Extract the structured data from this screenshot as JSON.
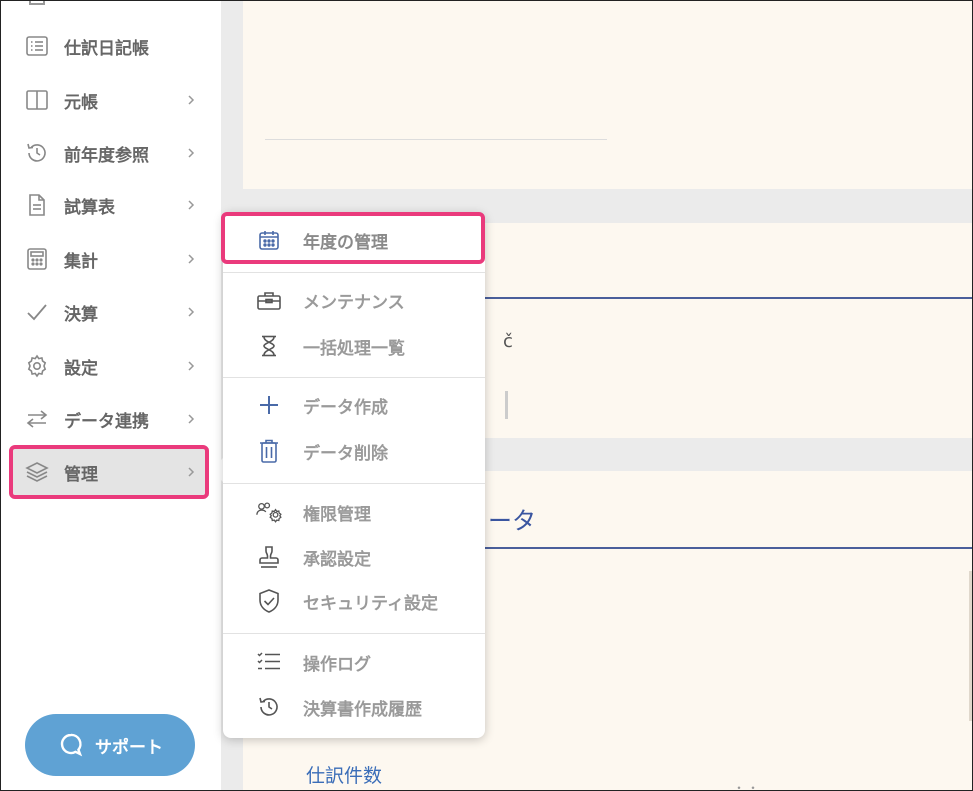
{
  "sidebar": {
    "items": [
      {
        "label": "仕訳日記帳",
        "icon": "list-icon",
        "chevron": false
      },
      {
        "label": "元帳",
        "icon": "book-icon",
        "chevron": true
      },
      {
        "label": "前年度参照",
        "icon": "history-icon",
        "chevron": true
      },
      {
        "label": "試算表",
        "icon": "document-icon",
        "chevron": true
      },
      {
        "label": "集計",
        "icon": "calculator-icon",
        "chevron": true
      },
      {
        "label": "決算",
        "icon": "check-icon",
        "chevron": true
      },
      {
        "label": "設定",
        "icon": "gear-icon",
        "chevron": true
      },
      {
        "label": "データ連携",
        "icon": "swap-icon",
        "chevron": true
      },
      {
        "label": "管理",
        "icon": "layers-icon",
        "chevron": true,
        "active": true
      }
    ],
    "support_label": "サポート"
  },
  "menu": {
    "items": [
      {
        "label": "年度の管理",
        "icon": "calendar-icon"
      },
      {
        "label": "メンテナンス",
        "icon": "toolbox-icon"
      },
      {
        "label": "一括処理一覧",
        "icon": "hourglass-icon"
      },
      {
        "label": "データ作成",
        "icon": "plus-icon"
      },
      {
        "label": "データ削除",
        "icon": "trash-icon"
      },
      {
        "label": "権限管理",
        "icon": "users-gear-icon"
      },
      {
        "label": "承認設定",
        "icon": "stamp-icon"
      },
      {
        "label": "セキュリティ設定",
        "icon": "shield-check-icon"
      },
      {
        "label": "操作ログ",
        "icon": "checklist-icon"
      },
      {
        "label": "決算書作成履歴",
        "icon": "history-icon"
      }
    ]
  },
  "main": {
    "partial_title": "ータ",
    "partial_fragment": "č",
    "journal_count_label": "仕訳件数",
    "dots": "・・"
  },
  "colors": {
    "highlight": "#ea3a7c",
    "support": "#5fa2d4",
    "accent_blue": "#3a55a0",
    "panel_bg": "#fdf8f0"
  }
}
